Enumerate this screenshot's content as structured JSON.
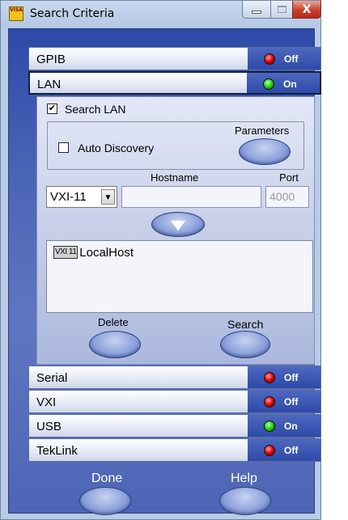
{
  "window": {
    "title": "Search Criteria",
    "icon_text": "VISA",
    "close_glyph": "X"
  },
  "sections": [
    {
      "label": "GPIB",
      "status": "Off",
      "led_color": "#e20000"
    },
    {
      "label": "LAN",
      "status": "On",
      "led_color": "#1bd400"
    },
    {
      "label": "Serial",
      "status": "Off",
      "led_color": "#e20000"
    },
    {
      "label": "VXI",
      "status": "Off",
      "led_color": "#e20000"
    },
    {
      "label": "USB",
      "status": "On",
      "led_color": "#1bd400"
    },
    {
      "label": "TekLink",
      "status": "Off",
      "led_color": "#e20000"
    }
  ],
  "lan": {
    "search_lan_label": "Search LAN",
    "search_lan_checked": true,
    "check_mark": "✔",
    "auto_discovery_label": "Auto Discovery",
    "auto_discovery_checked": false,
    "parameters_label": "Parameters",
    "protocol_value": "VXI-11",
    "select_arrow": "▼",
    "hostname_label": "Hostname",
    "hostname_value": "",
    "port_label": "Port",
    "port_value": "4000",
    "instruments": [
      {
        "tag": "VXI 11",
        "host": "LocalHost"
      }
    ],
    "delete_label": "Delete",
    "search_label": "Search"
  },
  "footer": {
    "done_label": "Done",
    "help_label": "Help"
  },
  "icons": [
    "app-icon",
    "minimize-icon",
    "maximize-icon",
    "close-icon",
    "status-led-icon",
    "down-arrow-icon",
    "dropdown-arrow-icon",
    "checkmark-icon"
  ]
}
